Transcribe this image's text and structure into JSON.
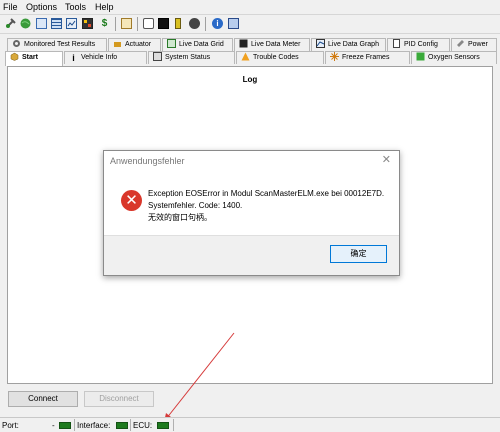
{
  "menu": [
    "File",
    "Options",
    "Tools",
    "Help"
  ],
  "toolbar": {
    "icons": [
      "connect-plug-icon",
      "globe-icon",
      "document-icon",
      "grid-icon",
      "chart-icon",
      "dtc-icon",
      "dollar-icon",
      "clipboard-icon",
      "chat-icon",
      "monitor-icon",
      "battery-icon",
      "record-icon",
      "info-icon",
      "exit-icon"
    ],
    "colors": {
      "led": "#1e7a1e"
    }
  },
  "tabs_row1": [
    {
      "label": "Monitored Test Results",
      "icon": "gear-icon"
    },
    {
      "label": "Actuator",
      "icon": "actuator-icon"
    },
    {
      "label": "Live Data Grid",
      "icon": "grid-icon"
    },
    {
      "label": "Live Data Meter",
      "icon": "meter-icon"
    },
    {
      "label": "Live Data Graph",
      "icon": "graph-icon"
    },
    {
      "label": "PID Config",
      "icon": "document-icon"
    },
    {
      "label": "Power",
      "icon": "power-icon"
    }
  ],
  "tabs_row2": [
    {
      "label": "Start",
      "icon": "start-icon"
    },
    {
      "label": "Vehicle Info",
      "icon": "info-icon"
    },
    {
      "label": "System Status",
      "icon": "status-icon"
    },
    {
      "label": "Trouble Codes",
      "icon": "warning-icon"
    },
    {
      "label": "Freeze Frames",
      "icon": "snowflake-icon"
    },
    {
      "label": "Oxygen Sensors",
      "icon": "sensor-icon"
    }
  ],
  "log": {
    "title": "Log"
  },
  "buttons": {
    "connect": "Connect",
    "disconnect": "Disconnect"
  },
  "statusbar": {
    "port_label": "Port:",
    "port_value": "-",
    "interface_label": "Interface:",
    "ecu_label": "ECU:"
  },
  "dialog": {
    "title": "Anwendungsfehler",
    "close": "✕",
    "icon": "error-icon",
    "line1": "Exception EOSError in Modul ScanMasterELM.exe bei 00012E7D.",
    "line2": "Systemfehler.  Code: 1400.",
    "line3": "无效的窗口句柄。",
    "ok": "确定"
  }
}
